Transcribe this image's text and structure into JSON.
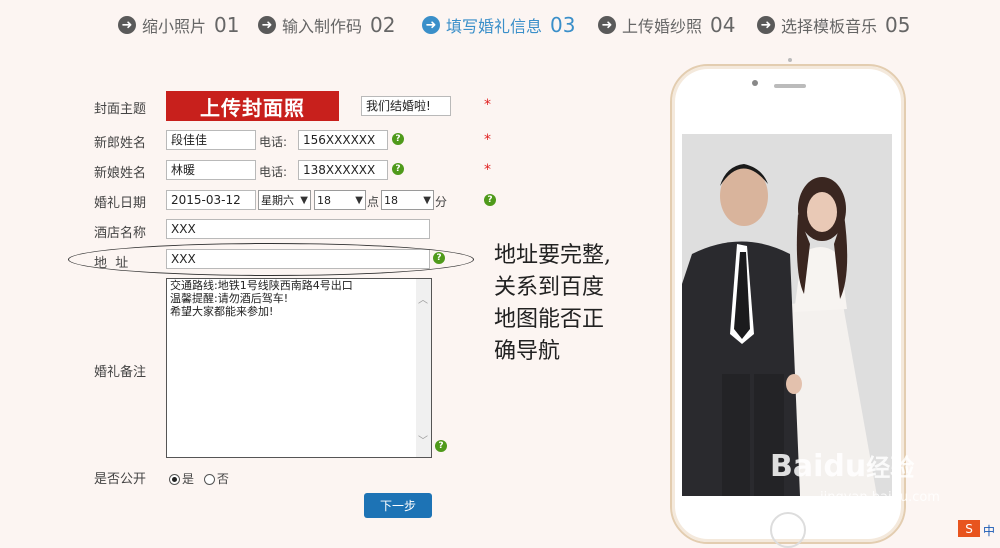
{
  "steps": [
    {
      "label": "缩小照片",
      "num": "01"
    },
    {
      "label": "输入制作码",
      "num": "02"
    },
    {
      "label": "填写婚礼信息",
      "num": "03"
    },
    {
      "label": "上传婚纱照",
      "num": "04"
    },
    {
      "label": "选择模板音乐",
      "num": "05"
    }
  ],
  "active_step": 3,
  "form": {
    "cover_label": "封面主题",
    "cover_button": "上传封面照",
    "cover_text": "我们结婚啦!",
    "groom_label": "新郎姓名",
    "groom_name": "段佳佳",
    "groom_phone_label": "电话:",
    "groom_phone": "156XXXXXX",
    "bride_label": "新娘姓名",
    "bride_name": "林暖",
    "bride_phone_label": "电话:",
    "bride_phone": "138XXXXXX",
    "date_label": "婚礼日期",
    "date_value": "2015-03-12",
    "weekday": "星期六",
    "hour": "18",
    "hour_unit": "点",
    "minute": "18",
    "minute_unit": "分",
    "hotel_label": "酒店名称",
    "hotel_value": "XXX",
    "address_label": "地  址",
    "address_value": "XXX",
    "remark_label": "婚礼备注",
    "remark_lines": [
      "交通路线:地铁1号线陕西南路4号出口",
      "温馨提醒:请勿酒后驾车!",
      "希望大家都能来参加!"
    ],
    "public_label": "是否公开",
    "public_yes": "是",
    "public_no": "否",
    "next_button": "下一步",
    "required_mark": "*",
    "help_mark": "?"
  },
  "annotation": [
    "地址要完整,",
    "关系到百度",
    "地图能否正",
    "确导航"
  ],
  "watermark": {
    "brand": "Baidu",
    "brand_cn": "经验",
    "url": "jingyan.baidu.com"
  },
  "ime_label": "S",
  "ime_text": "中",
  "colors": {
    "accent": "#3a8fc9",
    "cover_button": "#c8201c",
    "next_button": "#1d73b5",
    "required": "#e02020",
    "help": "#4f9a1b"
  }
}
